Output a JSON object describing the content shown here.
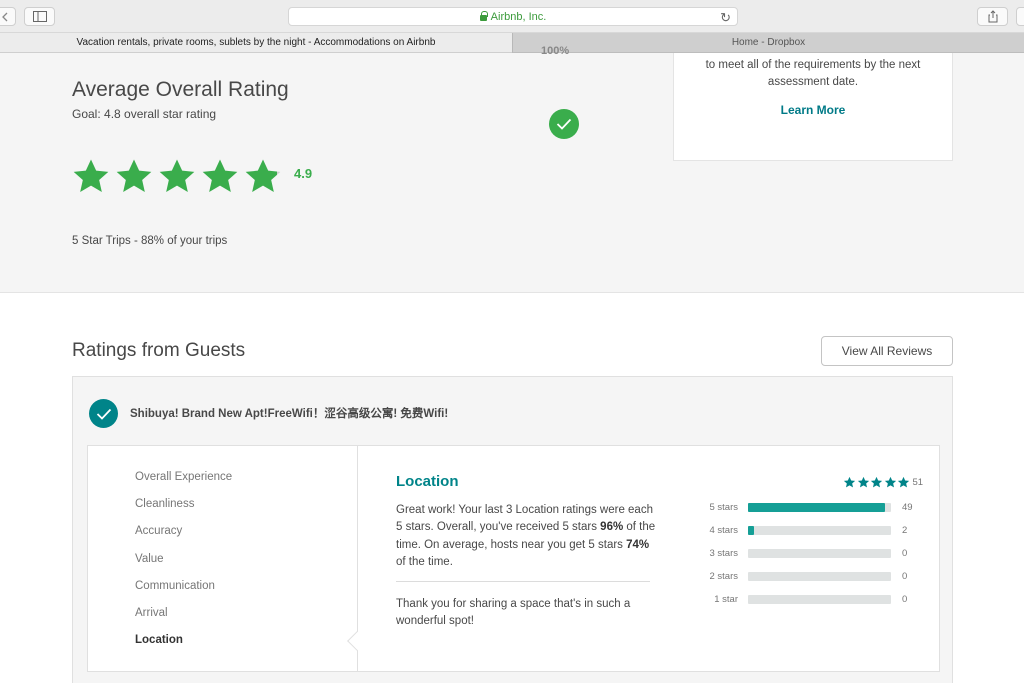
{
  "browser": {
    "url": "Airbnb, Inc.",
    "tabs": [
      {
        "title": "Vacation rentals, private rooms, sublets by the night - Accommodations on Airbnb",
        "active": true
      },
      {
        "title": "Home - Dropbox",
        "active": false
      }
    ]
  },
  "overview": {
    "partial_percent": "100%",
    "title": "Average Overall Rating",
    "goal": "Goal: 4.8 overall star rating",
    "rating": "4.9",
    "rating_value": 4.9,
    "five_star_trips": "5 Star Trips - 88% of your trips",
    "requirements_text": "to meet all of the requirements by the next assessment date.",
    "learn_more": "Learn More",
    "accent_color": "#3aad4c"
  },
  "ratings": {
    "section_title": "Ratings from Guests",
    "view_all": "View All Reviews",
    "listing_name": "Shibuya! Brand New Apt!FreeWifi！涩谷高级公寓! 免费Wifi!",
    "categories": [
      "Overall Experience",
      "Cleanliness",
      "Accuracy",
      "Value",
      "Communication",
      "Arrival",
      "Location"
    ],
    "selected_category": "Location",
    "detail": {
      "title": "Location",
      "para_1": "Great work! Your last 3 Location ratings were each 5 stars. Overall, you've received 5 stars ",
      "pct_5star": "96%",
      "para_2": " of the time. On average, hosts near you get 5 stars ",
      "pct_area": "74%",
      "para_3": " of the time.",
      "thanks": "Thank you for sharing a space that's in such a wonderful spot!",
      "total_reviews": "51",
      "accent_color": "#008489",
      "distribution": [
        {
          "label": "5 stars",
          "count": "49",
          "fraction": 0.96
        },
        {
          "label": "4 stars",
          "count": "2",
          "fraction": 0.04
        },
        {
          "label": "3 stars",
          "count": "0",
          "fraction": 0
        },
        {
          "label": "2 stars",
          "count": "0",
          "fraction": 0
        },
        {
          "label": "1 star",
          "count": "0",
          "fraction": 0
        }
      ]
    }
  }
}
